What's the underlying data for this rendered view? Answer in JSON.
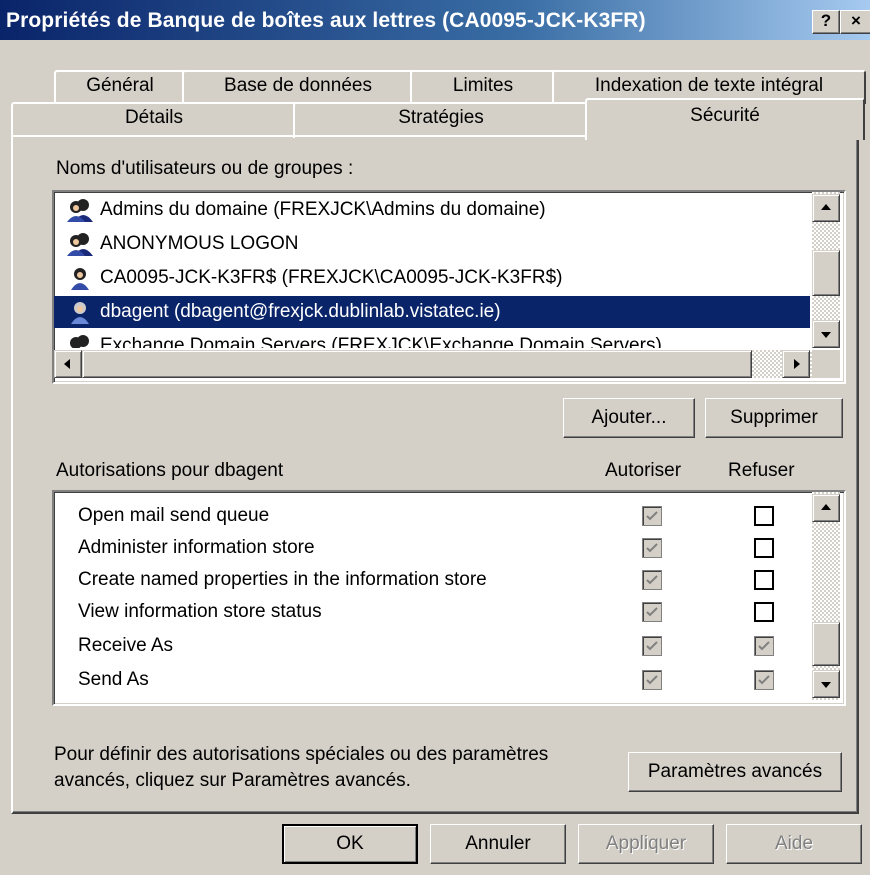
{
  "window": {
    "title": "Propriétés de Banque de boîtes aux lettres (CA0095-JCK-K3FR)",
    "help_button": "?",
    "close_button": "×"
  },
  "tabs_row1": [
    "Général",
    "Base de données",
    "Limites",
    "Indexation de texte intégral"
  ],
  "tabs_row2": [
    "Détails",
    "Stratégies",
    "Sécurité"
  ],
  "active_tab": "Sécurité",
  "users": {
    "label": "Noms d'utilisateurs ou de groupes :",
    "items": [
      {
        "name": "Admins du domaine (FREXJCK\\Admins du domaine)",
        "icon": "group-icon"
      },
      {
        "name": "ANONYMOUS LOGON",
        "icon": "group-icon"
      },
      {
        "name": "CA0095-JCK-K3FR$ (FREXJCK\\CA0095-JCK-K3FR$)",
        "icon": "user-icon"
      },
      {
        "name": "dbagent (dbagent@frexjck.dublinlab.vistatec.ie)",
        "icon": "user-icon",
        "selected": true
      },
      {
        "name": "Exchange Domain Servers (FREXJCK\\Exchange Domain Servers)",
        "icon": "group-icon"
      }
    ]
  },
  "buttons": {
    "add": "Ajouter...",
    "remove": "Supprimer",
    "advanced": "Paramètres avancés",
    "ok": "OK",
    "cancel": "Annuler",
    "apply": "Appliquer",
    "help": "Aide"
  },
  "permissions": {
    "label": "Autorisations pour dbagent",
    "allow_header": "Autoriser",
    "deny_header": "Refuser",
    "items": [
      {
        "name": "Open mail send queue",
        "allow": true,
        "allow_disabled": true,
        "deny": false,
        "deny_disabled": false
      },
      {
        "name": "Administer information store",
        "allow": true,
        "allow_disabled": true,
        "deny": false,
        "deny_disabled": false
      },
      {
        "name": "Create named properties in the information store",
        "allow": true,
        "allow_disabled": true,
        "deny": false,
        "deny_disabled": false
      },
      {
        "name": "View information store status",
        "allow": true,
        "allow_disabled": true,
        "deny": false,
        "deny_disabled": false
      },
      {
        "name": "Receive As",
        "allow": true,
        "allow_disabled": true,
        "deny": true,
        "deny_disabled": true
      },
      {
        "name": "Send As",
        "allow": true,
        "allow_disabled": true,
        "deny": true,
        "deny_disabled": true
      }
    ]
  },
  "info_text_line1": "Pour définir des autorisations spéciales ou des paramètres",
  "info_text_line2": "avancés, cliquez sur Paramètres avancés.",
  "colors": {
    "selection": "#0a246a",
    "face": "#d4d0c8",
    "title_start": "#0a246a",
    "title_end": "#a6caf0"
  }
}
